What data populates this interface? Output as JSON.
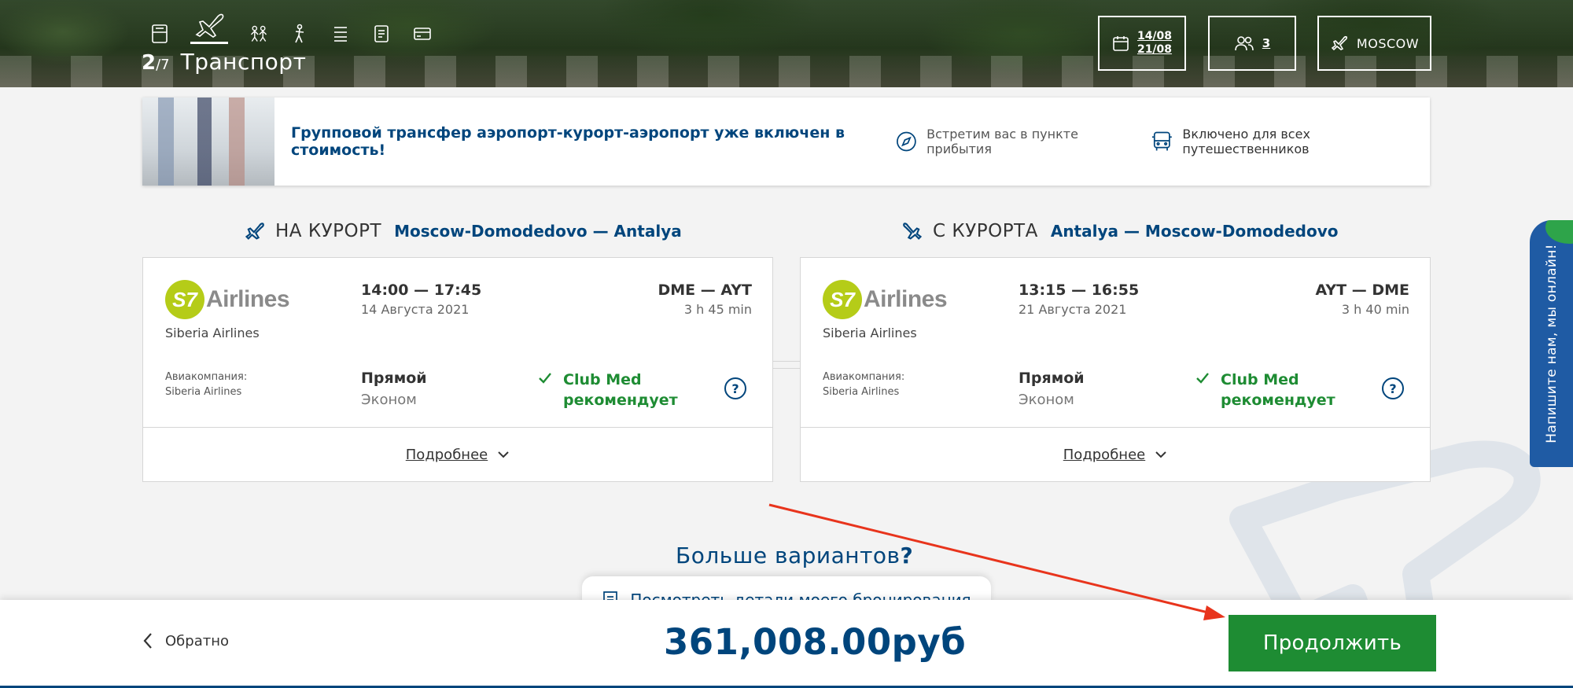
{
  "header": {
    "step_number": "2",
    "step_total": "/7",
    "step_title": "Транспорт",
    "date_from": "14/08",
    "date_to": "21/08",
    "travelers": "3",
    "departure_city": "MOSCOW",
    "step_icons": [
      "room-icon",
      "plane-icon",
      "activities-icon",
      "golf-icon",
      "list-icon",
      "notes-icon",
      "payment-icon"
    ]
  },
  "banner": {
    "text": "Групповой трансфер аэропорт-курорт-аэропорт уже включен в стоимость!",
    "feature_1": "Встретим вас в пункте прибытия",
    "feature_2": "Включено для всех путешественников"
  },
  "outbound": {
    "label": "НА КУРОРТ",
    "route": "Moscow-Domodedovo — Antalya",
    "logo_mark": "S7",
    "logo_word": "Airlines",
    "airline": "Siberia Airlines",
    "time": "14:00 — 17:45",
    "date": "14 Августа 2021",
    "airports": "DME — AYT",
    "duration": "3 h 45 min",
    "company_label": "Авиакомпания:",
    "company": "Siberia Airlines",
    "stops": "Прямой",
    "cabin": "Эконом",
    "recommend_1": "Club Med",
    "recommend_2": "рекомендует",
    "details": "Подробнее"
  },
  "return": {
    "label": "С КУРОРТА",
    "route": "Antalya — Moscow-Domodedovo",
    "logo_mark": "S7",
    "logo_word": "Airlines",
    "airline": "Siberia Airlines",
    "time": "13:15 — 16:55",
    "date": "21 Августа 2021",
    "airports": "AYT — DME",
    "duration": "3 h 40 min",
    "company_label": "Авиакомпания:",
    "company": "Siberia Airlines",
    "stops": "Прямой",
    "cabin": "Эконом",
    "recommend_1": "Club Med",
    "recommend_2": "рекомендует",
    "details": "Подробнее"
  },
  "chat": {
    "label": "Напишите нам, мы онлайн!"
  },
  "more_options": {
    "text": "Больше вариантов",
    "mark": "?"
  },
  "footer": {
    "booking_details": "Посмотреть детали моего бронирования",
    "back": "Обратно",
    "price": "361,008.00руб",
    "continue": "Продолжить"
  },
  "colors": {
    "brand_blue": "#00457c",
    "green": "#1e8c33",
    "s7_green": "#b5cc18",
    "chat_blue": "#1f5ba4",
    "annotation_red": "#e8341c"
  }
}
